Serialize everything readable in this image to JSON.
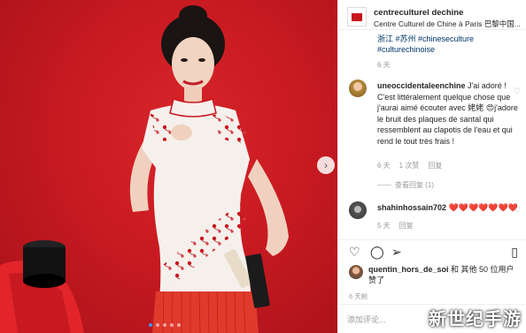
{
  "post": {
    "account": "centreculturel dechine",
    "account_display": "centreculturel­dechine",
    "subtitle": "Centre Culturel de Chine à Paris 巴黎中国...",
    "tags_line1": "浙江 #苏州 #chineseculture",
    "tags_line2": "#culturechinoise",
    "age": "6 天"
  },
  "comments": [
    {
      "user": "uneoccidentaleenchine",
      "text": " J'ai adoré ! C'est littéralement quelque chose que j'aurai aimé écouter avec 姥姥 😍j'adore le bruit des plaques de santal qui ressemblent au clapotis de l'eau et qui rend le tout très frais !",
      "age": "6 天",
      "likes": "1 次赞",
      "reply": "回复",
      "view_replies": "查看回复 (1)"
    },
    {
      "user": "shahinhossain702",
      "text": "❤️❤️❤️❤️❤️❤️❤️",
      "age": "5 天",
      "reply": "回复"
    }
  ],
  "likes": {
    "user": "quentin_hors_de_soi",
    "rest": " 和 其他 50 位用户赞了"
  },
  "post_age": "6 天前",
  "add_comment_placeholder": "添加评论...",
  "next_arrow": "›",
  "icons": {
    "like": "heart-outline-icon",
    "comment": "comment-icon",
    "share": "paper-plane-icon",
    "save": "bookmark-icon",
    "comment_like": "heart-outline-icon"
  },
  "watermark": "新世纪手游",
  "colors": {
    "photo_bg": "#c81a21",
    "link": "#003569",
    "accent": "#3897f0"
  }
}
